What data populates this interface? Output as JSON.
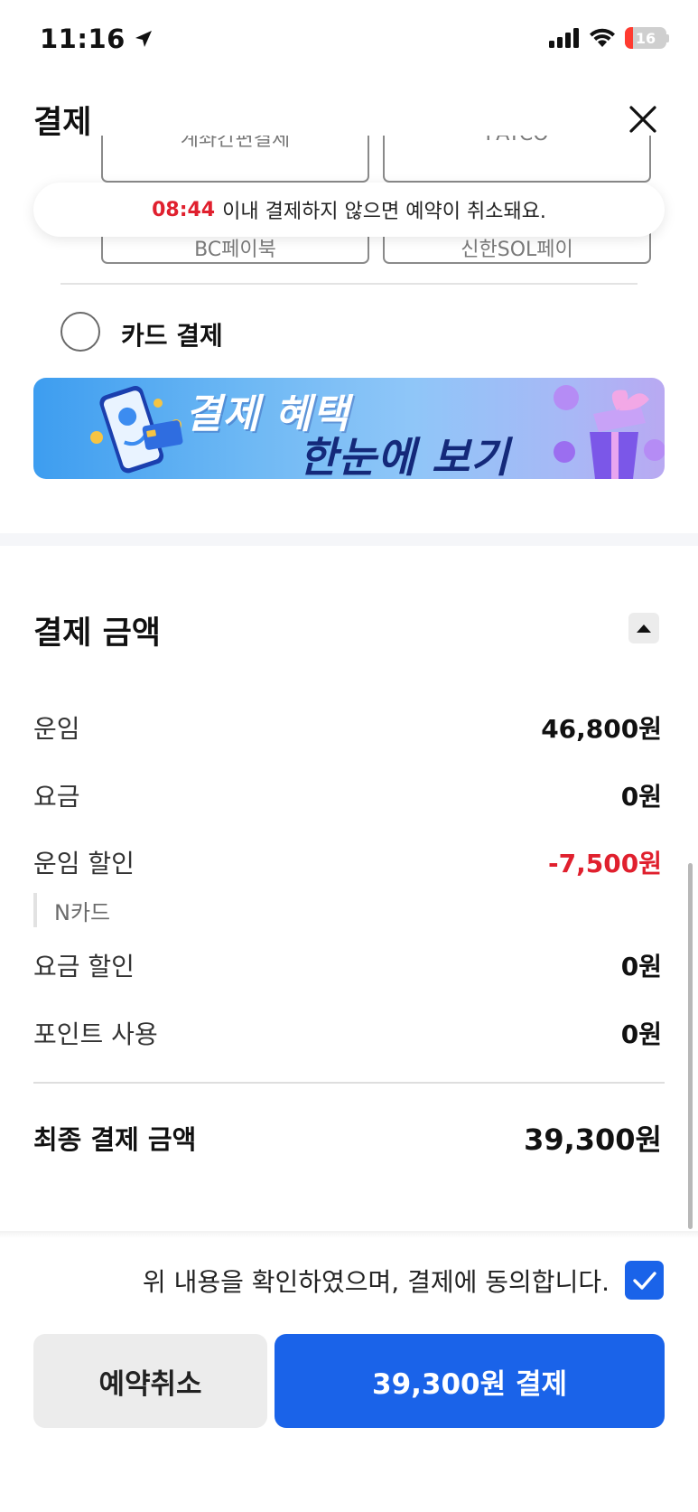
{
  "status_bar": {
    "time": "11:16",
    "battery": "16"
  },
  "header": {
    "title": "결제"
  },
  "payment_options_partial": {
    "option_a": "계좌간편결제",
    "option_b": "PAYCO",
    "option_c": "BC페이북",
    "option_d": "신한SOL페이"
  },
  "timer_toast": {
    "time": "08:44",
    "message": "이내 결제하지 않으면 예약이 취소돼요."
  },
  "card_payment": {
    "label": "카드 결제"
  },
  "banner": {
    "line1": "결제 혜택",
    "line2": "한눈에 보기"
  },
  "amount_section": {
    "title": "결제 금액",
    "rows": [
      {
        "label": "운임",
        "value": "46,800원"
      },
      {
        "label": "요금",
        "value": "0원"
      },
      {
        "label": "운임 할인",
        "value": "-7,500원",
        "sub": "N카드"
      },
      {
        "label": "요금 할인",
        "value": "0원"
      },
      {
        "label": "포인트 사용",
        "value": "0원"
      }
    ],
    "final_label": "최종 결제 금액",
    "final_value": "39,300원"
  },
  "agreement": {
    "text": "위 내용을 확인하였으며, 결제에 동의합니다.",
    "checked": true
  },
  "buttons": {
    "cancel": "예약취소",
    "pay": "39,300원 결제"
  },
  "colors": {
    "accent": "#1a63e9",
    "negative": "#e0202e"
  }
}
